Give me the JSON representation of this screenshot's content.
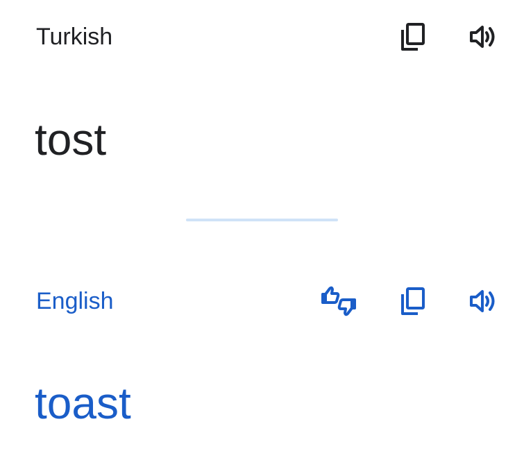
{
  "colors": {
    "source_text": "#202124",
    "translation_text": "#1a5dc8",
    "divider": "#cfe2f7",
    "background": "#ffffff"
  },
  "source": {
    "language": "Turkish",
    "text": "tost",
    "actions": [
      {
        "icon": "copy-icon"
      },
      {
        "icon": "speaker-icon"
      }
    ]
  },
  "translation": {
    "language": "English",
    "text": "toast",
    "actions": [
      {
        "icon": "thumbs-rating-icon"
      },
      {
        "icon": "copy-icon"
      },
      {
        "icon": "speaker-icon"
      }
    ]
  }
}
